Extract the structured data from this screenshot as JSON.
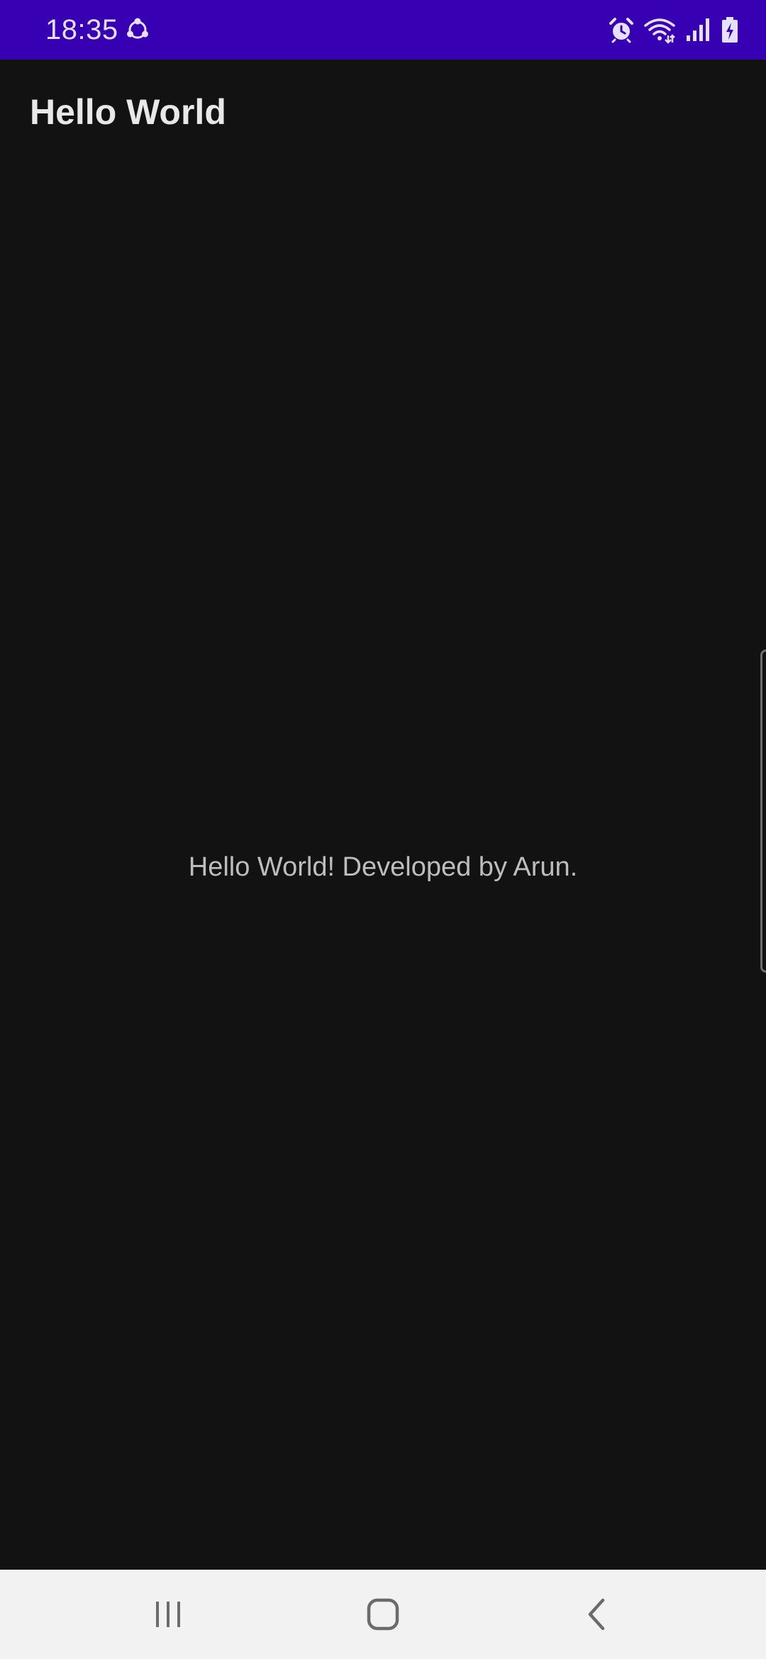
{
  "status_bar": {
    "time": "18:35",
    "background": "#3700B3",
    "left_icons": [
      "sync-icon"
    ],
    "right_icons": [
      "alarm-icon",
      "wifi-icon",
      "signal-icon",
      "battery-charging-icon"
    ]
  },
  "app_bar": {
    "title": "Hello World"
  },
  "main": {
    "message": "Hello World! Developed by Arun."
  },
  "nav_bar": {
    "buttons": [
      "recents-icon",
      "home-icon",
      "back-icon"
    ]
  },
  "colors": {
    "background": "#121212",
    "status_bar": "#3700B3",
    "nav_bar": "#F2F2F2"
  }
}
